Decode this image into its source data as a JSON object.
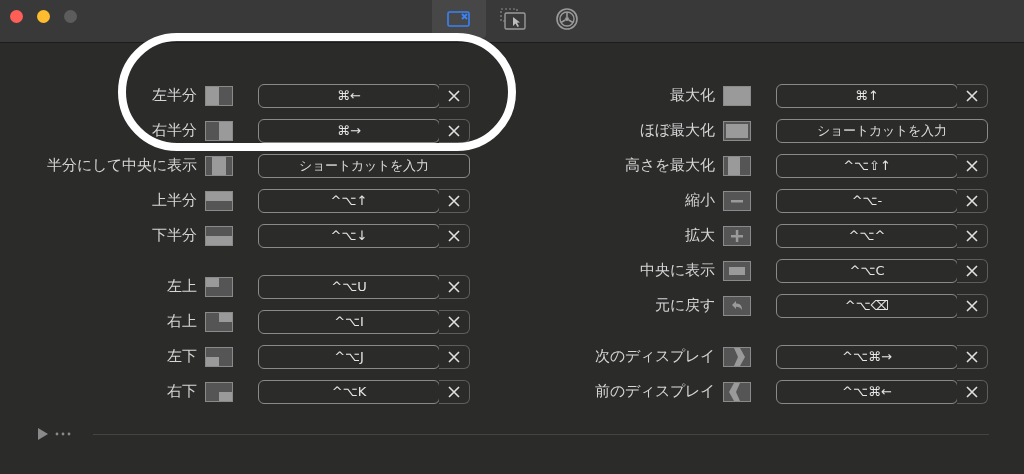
{
  "toolbar": {
    "tabs": [
      {
        "selected": true
      },
      {
        "selected": false
      },
      {
        "selected": false
      }
    ]
  },
  "left_column": {
    "groups": [
      [
        {
          "label": "左半分",
          "shortcut": "⌘←"
        },
        {
          "label": "右半分",
          "shortcut": "⌘→"
        },
        {
          "label": "半分にして中央に表示",
          "placeholder": "ショートカットを入力"
        },
        {
          "label": "上半分",
          "shortcut": "^⌥↑"
        },
        {
          "label": "下半分",
          "shortcut": "^⌥↓"
        }
      ],
      [
        {
          "label": "左上",
          "shortcut": "^⌥U"
        },
        {
          "label": "右上",
          "shortcut": "^⌥I"
        },
        {
          "label": "左下",
          "shortcut": "^⌥J"
        },
        {
          "label": "右下",
          "shortcut": "^⌥K"
        }
      ]
    ]
  },
  "right_column": {
    "groups": [
      [
        {
          "label": "最大化",
          "shortcut": "⌘↑"
        },
        {
          "label": "ほぼ最大化",
          "placeholder": "ショートカットを入力"
        },
        {
          "label": "高さを最大化",
          "shortcut": "^⌥⇧↑"
        },
        {
          "label": "縮小",
          "shortcut": "^⌥-"
        },
        {
          "label": "拡大",
          "shortcut": "^⌥^"
        },
        {
          "label": "中央に表示",
          "shortcut": "^⌥C"
        },
        {
          "label": "元に戻す",
          "shortcut": "^⌥⌫"
        }
      ],
      [
        {
          "label": "次のディスプレイ",
          "shortcut": "^⌥⌘→"
        },
        {
          "label": "前のディスプレイ",
          "shortcut": "^⌥⌘←"
        }
      ]
    ]
  }
}
